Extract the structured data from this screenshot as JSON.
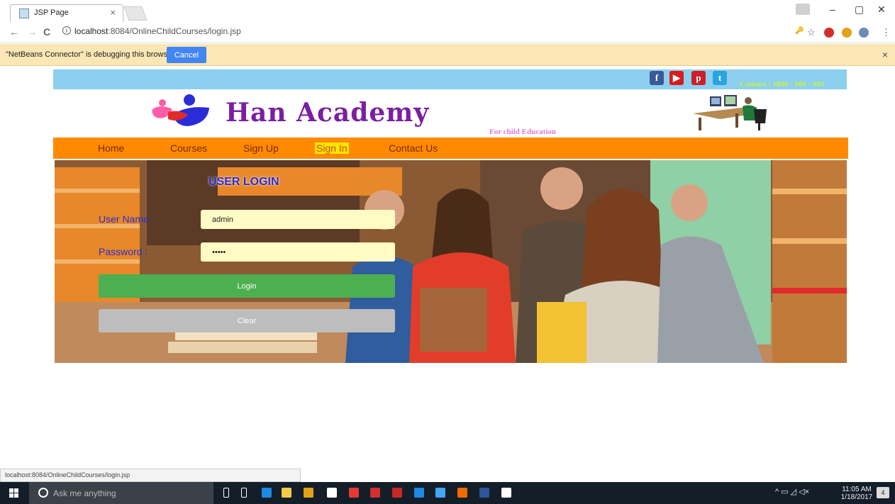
{
  "browser": {
    "tab_title": "JSP Page",
    "tab_close": "×",
    "url_host": "localhost",
    "url_rest": ":8084/OnlineChildCourses/login.jsp",
    "win_min": "–",
    "win_max": "▢",
    "win_close": "✕",
    "back_icon": "←",
    "forward_icon": "→",
    "reload_icon": "C",
    "info_icon": "i",
    "key_icon": "🔑",
    "star_icon": "☆",
    "menu_icon": "⋮"
  },
  "debugbar": {
    "message": "\"NetBeans Connector\" is debugging this browser.",
    "cancel_label": "Cancel",
    "close": "×"
  },
  "header": {
    "social": [
      {
        "name": "facebook",
        "glyph": "f",
        "color": "#3b5998"
      },
      {
        "name": "youtube",
        "glyph": "▶",
        "color": "#d81b1b"
      },
      {
        "name": "pinterest",
        "glyph": "p",
        "color": "#cb2027"
      },
      {
        "name": "twitter",
        "glyph": "t",
        "color": "#2aa4e0"
      }
    ],
    "contact": "Contact : 1800 - 000 - 001",
    "brand": "Han Academy",
    "tagline": "For child Education"
  },
  "nav": {
    "items": [
      "Home",
      "Courses",
      "Sign Up",
      "Sign In",
      "Contact Us"
    ],
    "active": "Sign In"
  },
  "login": {
    "title": "USER LOGIN",
    "username_label": "User Name :",
    "username_value": "admin",
    "password_label": "Password :",
    "password_value": "•••••",
    "login_label": "Login",
    "clear_label": "Clear",
    "login_color": "#4caf50",
    "clear_color": "#bdbdbd"
  },
  "status_url": "localhost:8084/OnlineChildCourses/login.jsp",
  "taskbar": {
    "search_placeholder": "Ask me anything",
    "time": "11:05 AM",
    "date": "1/18/2017",
    "notification_count": "4",
    "apps": [
      {
        "name": "mic",
        "color": "#ffffff"
      },
      {
        "name": "task-view",
        "color": "#ffffff"
      },
      {
        "name": "edge",
        "color": "#1e88e5"
      },
      {
        "name": "file-explorer",
        "color": "#f7c948"
      },
      {
        "name": "chrome",
        "color": "#e3a21a"
      },
      {
        "name": "store",
        "color": "#ffffff"
      },
      {
        "name": "mail",
        "color": "#e53935"
      },
      {
        "name": "acrobat",
        "color": "#d32f2f"
      },
      {
        "name": "mcafee",
        "color": "#c62828"
      },
      {
        "name": "teamviewer",
        "color": "#1e88e5"
      },
      {
        "name": "virtualbox",
        "color": "#42a5f5"
      },
      {
        "name": "xampp",
        "color": "#ef6c00"
      },
      {
        "name": "word",
        "color": "#2b579a"
      },
      {
        "name": "photos",
        "color": "#ffffff"
      }
    ]
  }
}
